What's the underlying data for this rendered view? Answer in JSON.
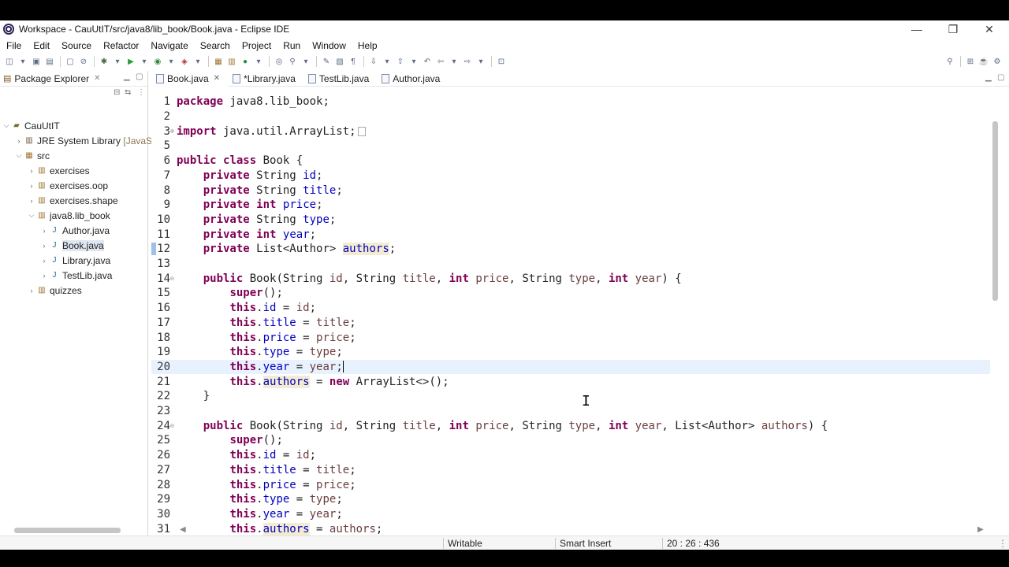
{
  "window": {
    "title": "Workspace - CauUtIT/src/java8/lib_book/Book.java - Eclipse IDE"
  },
  "window_controls": {
    "minimize": "—",
    "restore": "❐",
    "close": "✕"
  },
  "menu": [
    "File",
    "Edit",
    "Source",
    "Refactor",
    "Navigate",
    "Search",
    "Project",
    "Run",
    "Window",
    "Help"
  ],
  "package_explorer": {
    "title": "Package Explorer",
    "tree": {
      "project": "CauUtIT",
      "jre": "JRE System Library",
      "jre_suffix": "[JavaSE",
      "src": "src",
      "packages": [
        "exercises",
        "exercises.oop",
        "exercises.shape",
        "java8.lib_book",
        "quizzes"
      ],
      "files": [
        "Author.java",
        "Book.java",
        "Library.java",
        "TestLib.java"
      ]
    }
  },
  "editor_tabs": [
    {
      "label": "Book.java",
      "active": true
    },
    {
      "label": "*Library.java",
      "active": false
    },
    {
      "label": "TestLib.java",
      "active": false
    },
    {
      "label": "Author.java",
      "active": false
    }
  ],
  "code_lines": [
    {
      "n": "1",
      "text": "package java8.lib_book;"
    },
    {
      "n": "2",
      "text": ""
    },
    {
      "n": "3",
      "text": "import java.util.ArrayList;"
    },
    {
      "n": "5",
      "text": ""
    },
    {
      "n": "6",
      "text": "public class Book {"
    },
    {
      "n": "7",
      "text": "private String id;"
    },
    {
      "n": "8",
      "text": "private String title;"
    },
    {
      "n": "9",
      "text": "private int price;"
    },
    {
      "n": "10",
      "text": "private String type;"
    },
    {
      "n": "11",
      "text": "private int year;"
    },
    {
      "n": "12",
      "text": "private List<Author> authors;"
    },
    {
      "n": "13",
      "text": ""
    },
    {
      "n": "14",
      "text": "public Book(String id, String title, int price, String type, int year) {"
    },
    {
      "n": "15",
      "text": "super();"
    },
    {
      "n": "16",
      "text": "this.id = id;"
    },
    {
      "n": "17",
      "text": "this.title = title;"
    },
    {
      "n": "18",
      "text": "this.price = price;"
    },
    {
      "n": "19",
      "text": "this.type = type;"
    },
    {
      "n": "20",
      "text": "this.year = year;"
    },
    {
      "n": "21",
      "text": "this.authors = new ArrayList<>();"
    },
    {
      "n": "22",
      "text": "}"
    },
    {
      "n": "23",
      "text": ""
    },
    {
      "n": "24",
      "text": "public Book(String id, String title, int price, String type, int year, List<Author> authors) {"
    },
    {
      "n": "25",
      "text": "super();"
    },
    {
      "n": "26",
      "text": "this.id = id;"
    },
    {
      "n": "27",
      "text": "this.title = title;"
    },
    {
      "n": "28",
      "text": "this.price = price;"
    },
    {
      "n": "29",
      "text": "this.type = type;"
    },
    {
      "n": "30",
      "text": "this.year = year;"
    },
    {
      "n": "31",
      "text": "this.authors = authors;"
    }
  ],
  "status": {
    "writable": "Writable",
    "insert_mode": "Smart Insert",
    "position": "20 : 26 : 436"
  },
  "colors": {
    "keyword": "#7f0055",
    "field": "#0000c0",
    "occurrence_highlight": "#f3ecd2",
    "current_line": "#e8f2fe"
  }
}
